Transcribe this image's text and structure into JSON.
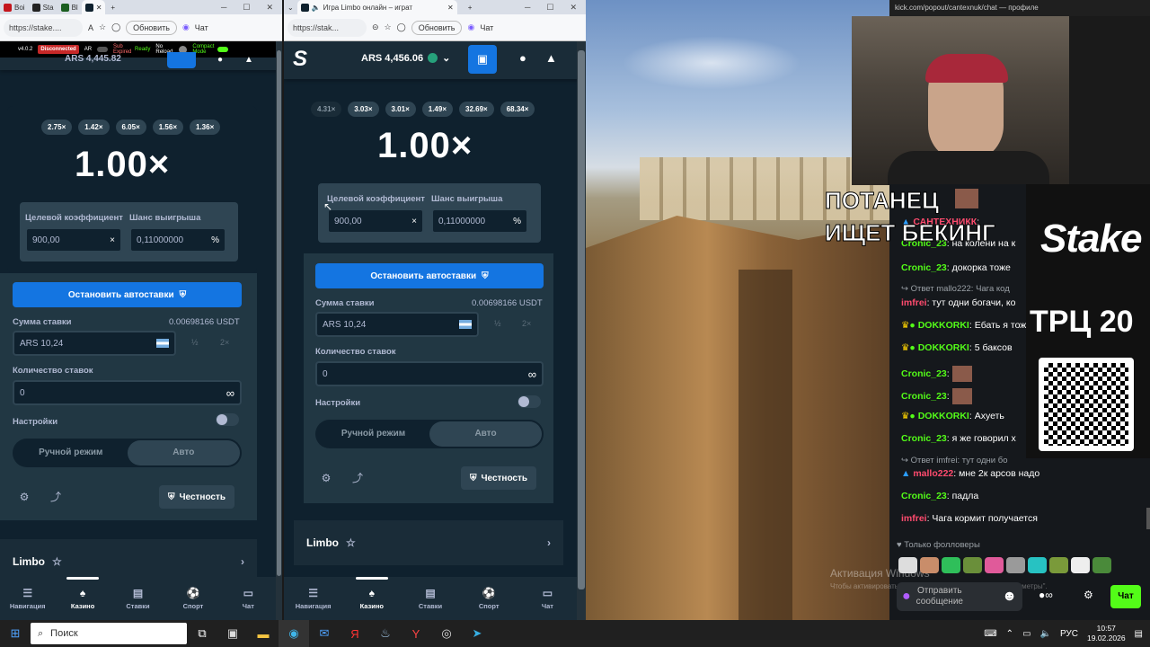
{
  "left_window": {
    "tabs": [
      "Boi",
      "Sta",
      "Bl",
      ""
    ],
    "address": "https://stake....",
    "refresh": "Обновить",
    "chat": "Чат",
    "ext": {
      "version": "v4.0.2",
      "status": "Disconnected",
      "auto": "AR",
      "sub": "Sub Expired",
      "ready": "Ready",
      "no": "No Reload",
      "compact": "Compact Mode"
    },
    "balance": "ARS 4,445.82",
    "multipliers": [
      "2.75×",
      "1.42×",
      "6.05×",
      "1.56×",
      "1.36×"
    ],
    "big_multiplier": "1.00×",
    "target_label": "Целевой коэффициент",
    "chance_label": "Шанс выигрыша",
    "target_value": "900,00",
    "chance_value": "0,11000000",
    "clear": "×",
    "percent": "%",
    "stop_button": "Остановить автоставки",
    "bet_label": "Сумма ставки",
    "bet_usdt": "0.00698166 USDT",
    "bet_value": "ARS 10,24",
    "half": "½",
    "double": "2×",
    "count_label": "Количество ставок",
    "count_value": "0",
    "infinity": "∞",
    "settings_label": "Настройки",
    "mode_manual": "Ручной режим",
    "mode_auto": "Авто",
    "fairness": "Честность",
    "game_name": "Limbo",
    "nav": [
      "Навигация",
      "Казино",
      "Ставки",
      "Спорт",
      "Чат"
    ]
  },
  "mid_window": {
    "tab_title": "Игра Limbo онлайн – играт",
    "address": "https://stak...",
    "refresh": "Обновить",
    "chat": "Чат",
    "balance": "ARS 4,456.06",
    "multipliers": [
      "4.31×",
      "3.03×",
      "3.01×",
      "1.49×",
      "32.69×",
      "68.34×"
    ],
    "big_multiplier": "1.00×",
    "target_label": "Целевой коэффициент",
    "chance_label": "Шанс выигрыша",
    "target_value": "900,00",
    "chance_value": "0,11000000",
    "clear": "×",
    "percent": "%",
    "stop_button": "Остановить автоставки",
    "bet_label": "Сумма ставки",
    "bet_usdt": "0.00698166 USDT",
    "bet_value": "ARS 10,24",
    "half": "½",
    "double": "2×",
    "count_label": "Количество ставок",
    "count_value": "0",
    "infinity": "∞",
    "settings_label": "Настройки",
    "mode_manual": "Ручной режим",
    "mode_auto": "Авто",
    "fairness": "Честность",
    "game_name": "Limbo",
    "nav": [
      "Навигация",
      "Казино",
      "Ставки",
      "Спорт",
      "Чат"
    ]
  },
  "stream": {
    "top_url": "kick.com/popout/cantexnuk/chat — профиле",
    "overlay_line1": "ПОТАНЕЦ",
    "overlay_line2": "ИЩЕТ БЕКИНГ",
    "stake_logo": "Stake",
    "trc": "ТРЦ 20",
    "watermark1": "Активация Windows",
    "watermark2": "Чтобы активировать Windows, перейдите в раздел \"Параметры\".",
    "followers_only": "Только фолловеры",
    "send_message": "Отправить\nсообщение",
    "chat_button": "Чат",
    "messages": [
      {
        "nick": "САНТЕХНИКК",
        "text": ":",
        "color": "#ff4b6e"
      },
      {
        "nick": "Cronic_23",
        "text": ": на колени на к",
        "color": "#53fc18"
      },
      {
        "nick": "Cronic_23",
        "text": ": докорка тоже",
        "color": "#53fc18"
      },
      {
        "system": "↪ Ответ mallo222: Чага код"
      },
      {
        "nick": "imfrei",
        "text": ": тут одни богачи, ко",
        "color": "#ff4b6e"
      },
      {
        "nick": "DOKKORKI",
        "text": ": Ебать я тоже",
        "color": "#53fc18"
      },
      {
        "nick": "DOKKORKI",
        "text": ": 5 баксов",
        "color": "#53fc18"
      },
      {
        "nick": "Cronic_23",
        "text": ":",
        "color": "#53fc18"
      },
      {
        "nick": "Cronic_23",
        "text": ":",
        "color": "#53fc18"
      },
      {
        "nick": "DOKKORKI",
        "text": ": Ахуеть",
        "color": "#53fc18"
      },
      {
        "nick": "Cronic_23",
        "text": ": я же говорил х",
        "color": "#53fc18"
      },
      {
        "system": "↪ Ответ imfrei: тут одни бо"
      },
      {
        "nick": "mallo222",
        "text": ": мне 2к арсов надо",
        "color": "#ff4b6e"
      },
      {
        "nick": "Cronic_23",
        "text": ": падла",
        "color": "#53fc18"
      },
      {
        "nick": "imfrei",
        "text": ": Чага кормит получается",
        "color": "#ff4b6e"
      }
    ]
  },
  "taskbar": {
    "search": "Поиск",
    "lang": "РУС",
    "time": "10:57",
    "date": "19.02.2026"
  },
  "colors": {
    "stake_bg": "#0f212e",
    "panel": "#213743",
    "field": "#2f4553",
    "blue": "#1475e1",
    "kick_green": "#53fc18"
  }
}
